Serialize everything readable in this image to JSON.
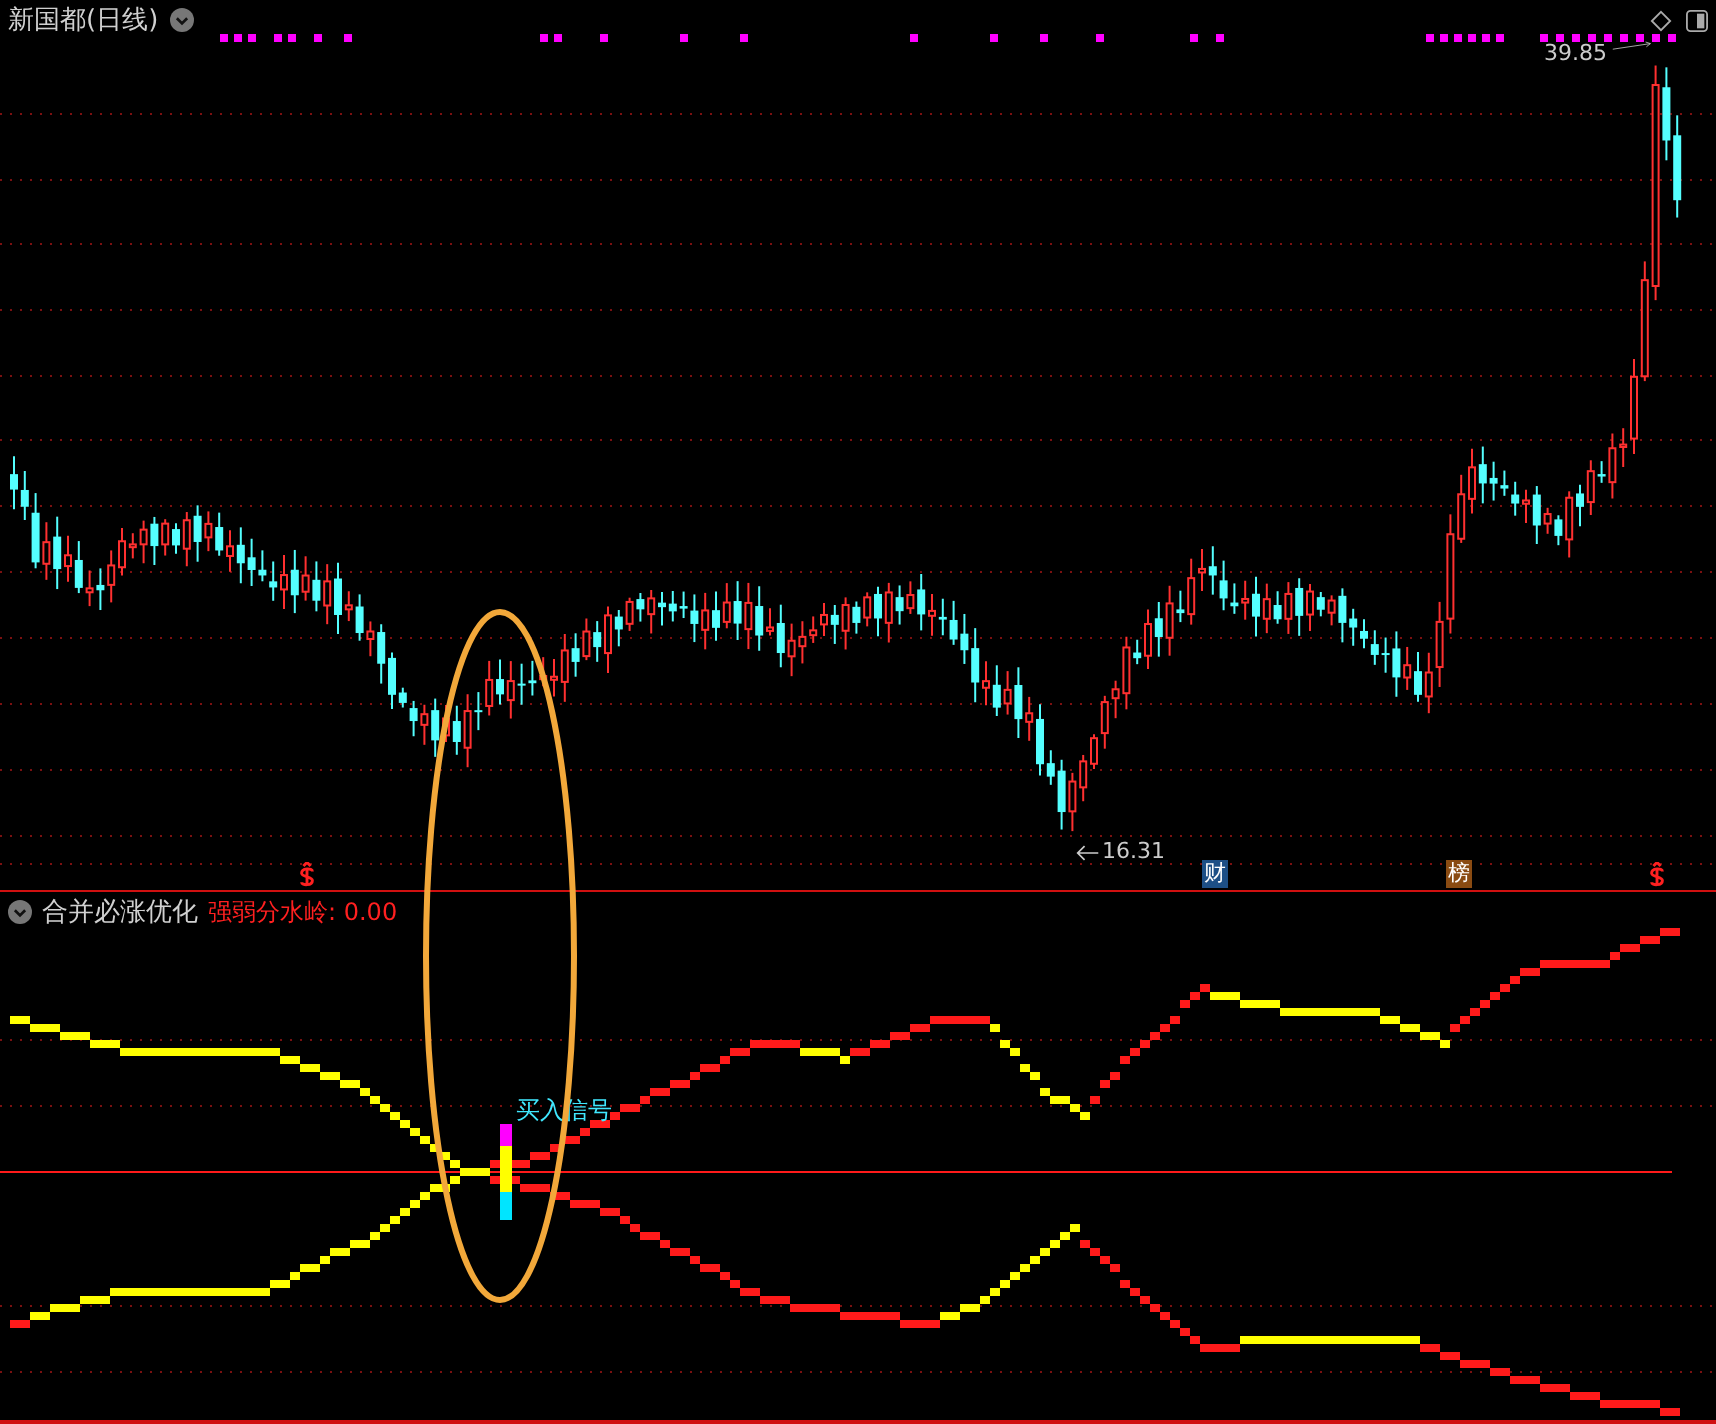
{
  "window": {
    "title": "新国都(日线)"
  },
  "price_chart": {
    "high_label": "39.85",
    "low_label": "16.31",
    "markers": [
      {
        "kind": "finance",
        "text": "财",
        "color": "#1d4f86"
      },
      {
        "kind": "rank",
        "text": "榜",
        "color": "#8a4b12"
      }
    ]
  },
  "indicator": {
    "name": "合并必涨优化",
    "reading": "强弱分水岭: 0.00",
    "signal_label": "买入信号"
  }
}
